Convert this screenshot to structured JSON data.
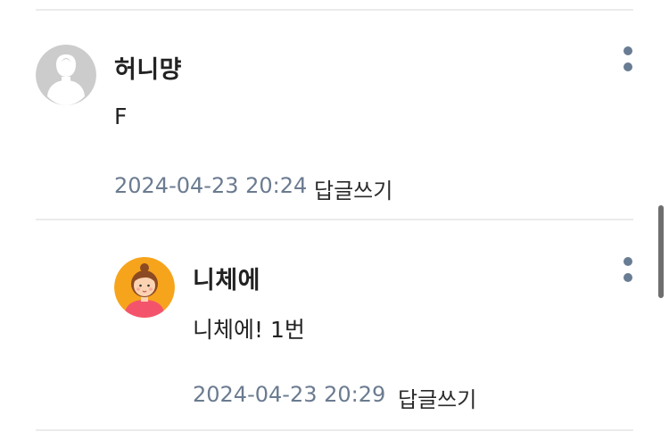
{
  "comments": [
    {
      "nickname": "허니먕",
      "body": "F",
      "date": "2024-04-23 20:24",
      "reply_label": "답글쓰기",
      "avatar_icon": "default-user-icon"
    },
    {
      "nickname": "니체에",
      "body": "니체에! 1번",
      "date": "2024-04-23 20:29",
      "reply_label": "답글쓰기",
      "avatar_icon": "girl-character-icon"
    }
  ],
  "more_icon": "more-vertical-icon",
  "colors": {
    "date": "#6b7b90",
    "divider": "#ebebeb",
    "more_dots": "#687c93",
    "avatar_orange": "#f7a41d"
  }
}
